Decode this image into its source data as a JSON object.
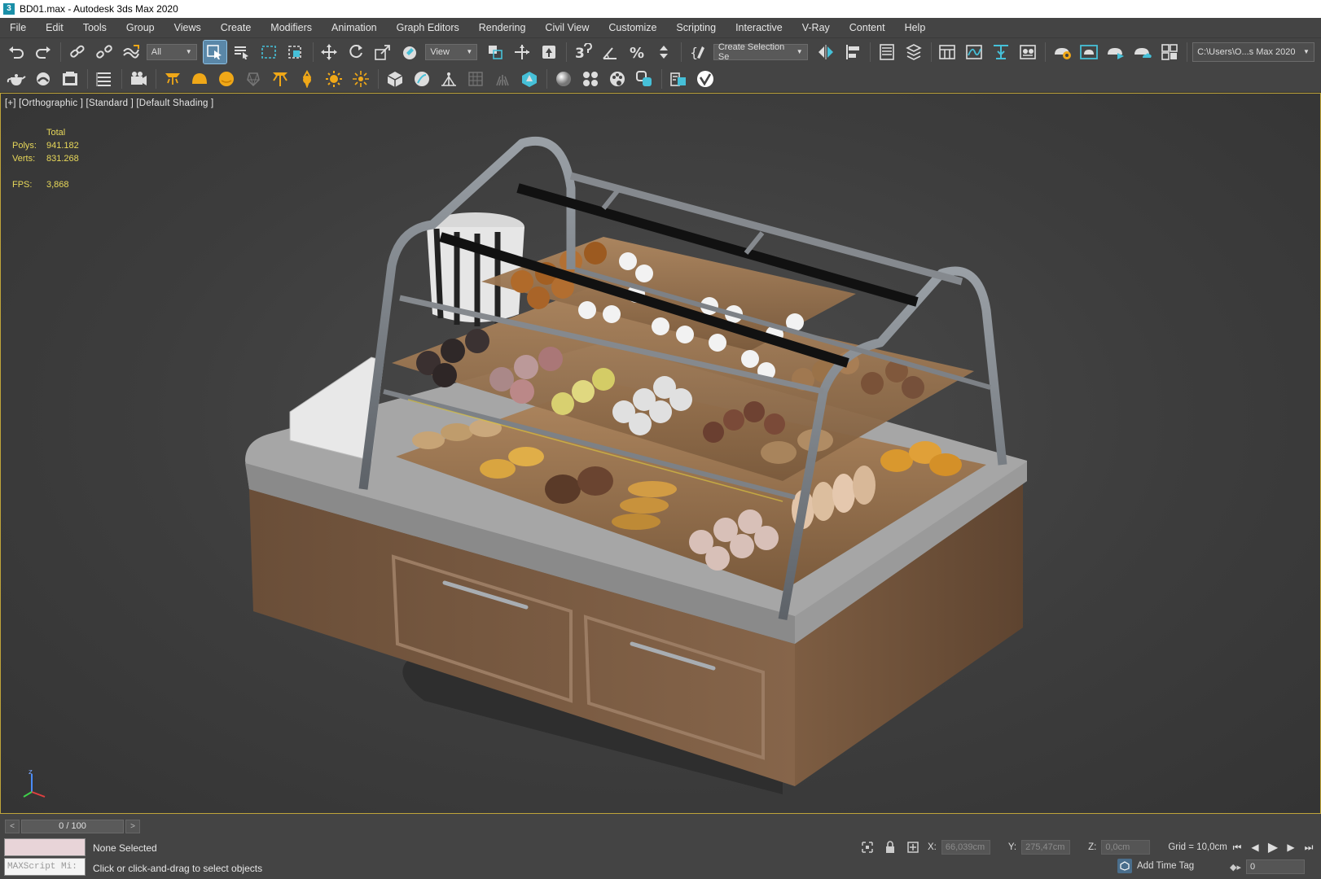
{
  "window": {
    "app_icon_text": "3",
    "title": "BD01.max - Autodesk 3ds Max 2020"
  },
  "menu": [
    "File",
    "Edit",
    "Tools",
    "Group",
    "Views",
    "Create",
    "Modifiers",
    "Animation",
    "Graph Editors",
    "Rendering",
    "Civil View",
    "Customize",
    "Scripting",
    "Interactive",
    "V-Ray",
    "Content",
    "Help"
  ],
  "toolbar": {
    "filter_dropdown": "All",
    "refcoord_dropdown": "View",
    "selection_set_dropdown": "Create Selection Se",
    "project_path": "C:\\Users\\O...s Max 2020"
  },
  "viewport": {
    "label": "[+] [Orthographic ] [Standard ] [Default Shading ]",
    "stats": {
      "total_label": "Total",
      "polys_label": "Polys:",
      "polys_value": "941.182",
      "verts_label": "Verts:",
      "verts_value": "831.268",
      "fps_label": "FPS:",
      "fps_value": "3,868"
    }
  },
  "timeline": {
    "prev": "<",
    "next": ">",
    "position": "0 / 100"
  },
  "status": {
    "maxscript_placeholder": "MAXScript Mi:",
    "selection": "None Selected",
    "prompt": "Click or click-and-drag to select objects",
    "x_label": "X:",
    "x_value": "66,039cm",
    "y_label": "Y:",
    "y_value": "275,47cm",
    "z_label": "Z:",
    "z_value": "0,0cm",
    "grid": "Grid = 10,0cm",
    "add_time_tag": "Add Time Tag",
    "frame": "0"
  },
  "colors": {
    "ui_bg": "#444444",
    "viewport_border": "#bfa43a",
    "stats_text": "#e8d85a",
    "active_tool": "#5a87a8",
    "icon_orange": "#f0a818",
    "icon_teal": "#46c0d8"
  }
}
